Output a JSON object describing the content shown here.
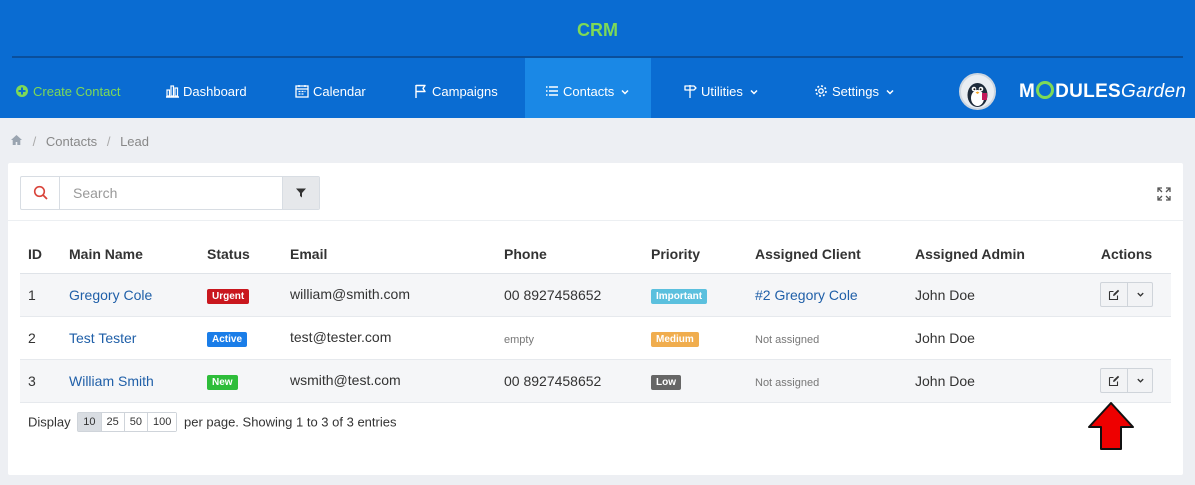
{
  "header": {
    "title": "CRM",
    "nav": [
      {
        "label": "Create Contact",
        "icon": "plus-circle-icon"
      },
      {
        "label": "Dashboard",
        "icon": "bar-chart-icon"
      },
      {
        "label": "Calendar",
        "icon": "calendar-icon"
      },
      {
        "label": "Campaigns",
        "icon": "flag-icon"
      },
      {
        "label": "Contacts",
        "icon": "list-icon"
      },
      {
        "label": "Utilities",
        "icon": "signpost-icon"
      },
      {
        "label": "Settings",
        "icon": "gear-icon"
      }
    ],
    "brand": {
      "part1": "M",
      "part2": "DULES",
      "part3": "Garden"
    }
  },
  "breadcrumb": {
    "items": [
      "Contacts",
      "Lead"
    ]
  },
  "search": {
    "placeholder": "Search"
  },
  "table": {
    "headers": [
      "ID",
      "Main Name",
      "Status",
      "Email",
      "Phone",
      "Priority",
      "Assigned Client",
      "Assigned Admin",
      "Actions"
    ],
    "rows": [
      {
        "id": "1",
        "name": "Gregory Cole",
        "status": "Urgent",
        "email": "william@smith.com",
        "phone": "00 8927458652",
        "priority": "Important",
        "client": "#2 Gregory Cole",
        "admin": "John Doe"
      },
      {
        "id": "2",
        "name": "Test Tester",
        "status": "Active",
        "email": "test@tester.com",
        "phone": "empty",
        "priority": "Medium",
        "client": "Not assigned",
        "admin": "John Doe"
      },
      {
        "id": "3",
        "name": "William Smith",
        "status": "New",
        "email": "wsmith@test.com",
        "phone": "00 8927458652",
        "priority": "Low",
        "client": "Not assigned",
        "admin": "John Doe"
      }
    ]
  },
  "pager": {
    "display_label": "Display",
    "options": [
      "10",
      "25",
      "50",
      "100"
    ],
    "selected": "10",
    "summary": "per page. Showing 1 to 3 of 3 entries"
  },
  "colors": {
    "header_bg": "#0a6cd2",
    "accent_green": "#7ed957",
    "status_urgent": "#c9171e",
    "status_active": "#1a7de8",
    "status_new": "#2ebd3a",
    "priority_important": "#5bc0de",
    "priority_medium": "#f0ad4e",
    "priority_low": "#666666"
  }
}
